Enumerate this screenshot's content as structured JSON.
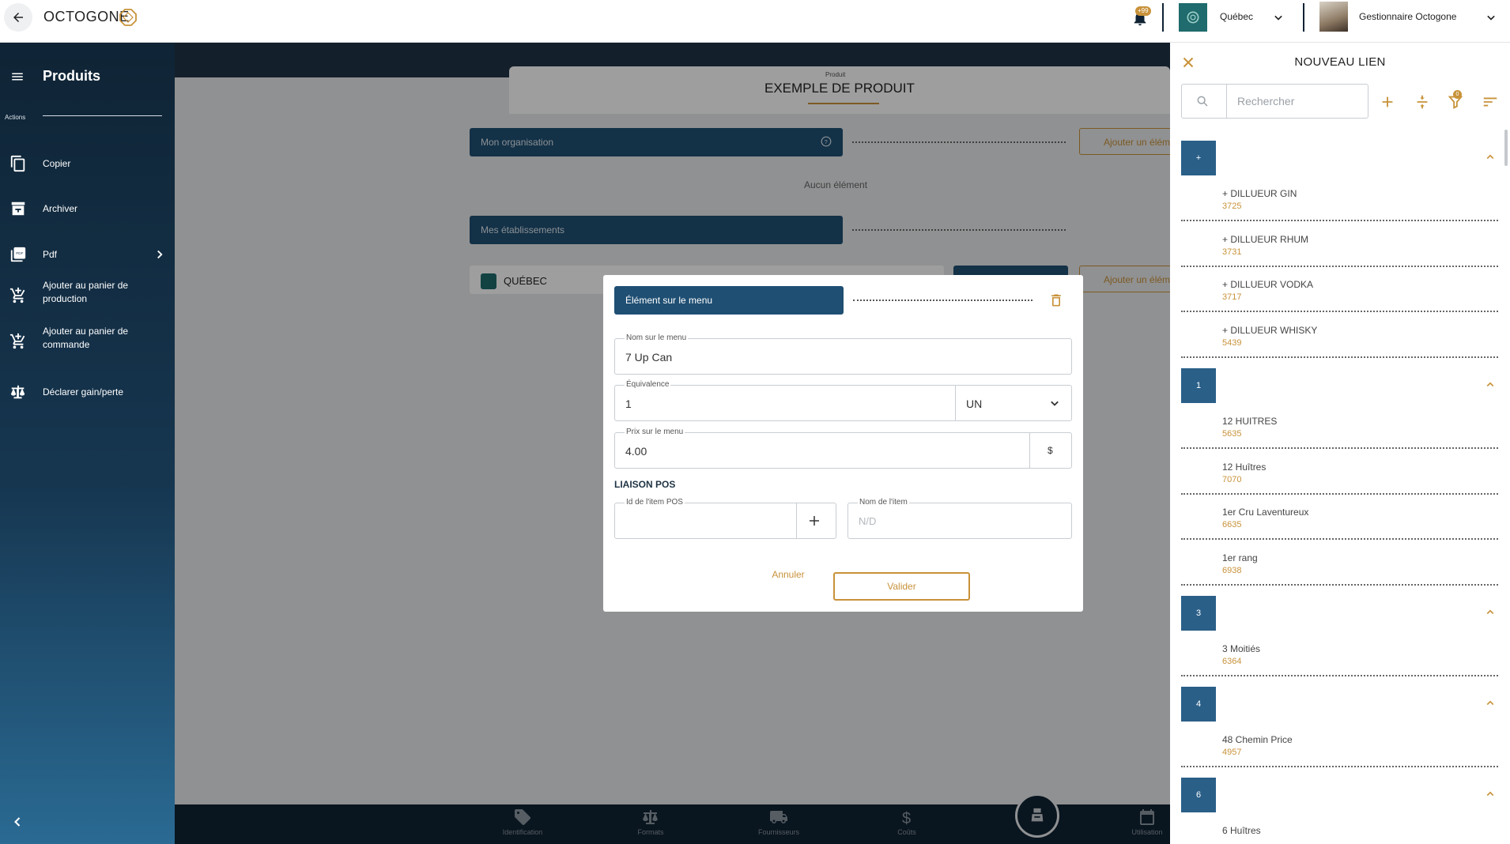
{
  "topbar": {
    "logo_text": "OCTOGONE",
    "notification_count": "+99",
    "organization": "Québec",
    "user_name": "Gestionnaire Octogone"
  },
  "sidebar": {
    "title": "Produits",
    "section_label": "Actions",
    "items": [
      {
        "label": "Copier",
        "icon": "copy-icon"
      },
      {
        "label": "Archiver",
        "icon": "archive-icon"
      },
      {
        "label": "Pdf",
        "icon": "pdf-icon"
      },
      {
        "label": "Ajouter au panier de production",
        "icon": "cart-add-icon"
      },
      {
        "label": "Ajouter au panier de commande",
        "icon": "cart-add-icon"
      },
      {
        "label": "Déclarer gain/perte",
        "icon": "scale-icon"
      }
    ]
  },
  "background": {
    "product_subtitle": "Produit",
    "product_title": "EXEMPLE DE PRODUIT",
    "org_field": "Mon organisation",
    "add_button": "Ajouter un élément",
    "empty_label": "Aucun élément",
    "est_field": "Mes établissements",
    "est_name": "QUÉBEC",
    "bottom_nav": [
      {
        "label": "Identification",
        "icon": "tag-icon"
      },
      {
        "label": "Formats",
        "icon": "scale-icon"
      },
      {
        "label": "Fournisseurs",
        "icon": "truck-icon"
      },
      {
        "label": "Coûts",
        "icon": "dollar-icon"
      },
      {
        "label": "Utilisation",
        "icon": "calendar-icon"
      }
    ]
  },
  "dialog": {
    "header": "Élément sur le menu",
    "menu_name_label": "Nom sur le menu",
    "menu_name_value": "7 Up Can",
    "equivalence_label": "Équivalence",
    "equivalence_value": "1",
    "unit_value": "UN",
    "price_label": "Prix sur le menu",
    "price_value": "4.00",
    "currency": "$",
    "pos_section": "LIAISON POS",
    "pos_id_label": "Id de l'item POS",
    "pos_name_label": "Nom de l'item",
    "pos_name_placeholder": "N/D",
    "cancel_label": "Annuler",
    "validate_label": "Valider"
  },
  "panel": {
    "title": "NOUVEAU LIEN",
    "search_placeholder": "Rechercher",
    "filter_count": "0",
    "groups": [
      {
        "key": "+",
        "items": [
          {
            "name": "+ DILLUEUR GIN",
            "code": "3725"
          },
          {
            "name": "+ DILLUEUR RHUM",
            "code": "3731"
          },
          {
            "name": "+ DILLUEUR VODKA",
            "code": "3717"
          },
          {
            "name": "+ DILLUEUR WHISKY",
            "code": "5439"
          }
        ]
      },
      {
        "key": "1",
        "items": [
          {
            "name": "12 HUITRES",
            "code": "5635"
          },
          {
            "name": "12 Huîtres",
            "code": "7070"
          },
          {
            "name": "1er Cru Laventureux",
            "code": "6635"
          },
          {
            "name": "1er rang",
            "code": "6938"
          }
        ]
      },
      {
        "key": "3",
        "items": [
          {
            "name": "3 Moitiés",
            "code": "6364"
          }
        ]
      },
      {
        "key": "4",
        "items": [
          {
            "name": "48 Chemin Price",
            "code": "4957"
          }
        ]
      },
      {
        "key": "6",
        "items": [
          {
            "name": "6 Huîtres",
            "code": ""
          }
        ]
      }
    ]
  },
  "colors": {
    "navy": "#0f2233",
    "field_blue": "#1f4f73",
    "group_blue": "#2a5f88",
    "accent_gold": "#c8923a",
    "teal": "#1f6b6d"
  }
}
